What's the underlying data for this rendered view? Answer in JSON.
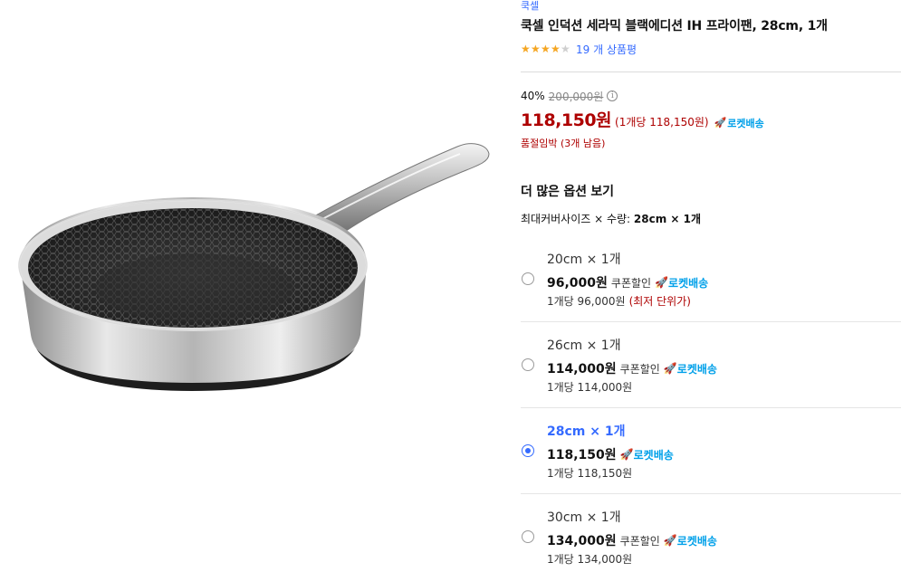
{
  "product": {
    "brand": "쿡셀",
    "title": "쿡셀 인덕션 세라믹 블랙에디션 IH 프라이팬, 28cm, 1개",
    "rating": 4,
    "rating_max": 5,
    "review_count": "19 개 상품평"
  },
  "price": {
    "discount_rate": "40%",
    "original_price": "200,000원",
    "info_icon": "i",
    "sale_price": "118,150원",
    "unit_price": "(1개당 118,150원)",
    "rocket_label": "로켓배송",
    "stock_text": "품절임박 (3개 남음)"
  },
  "options_section": {
    "title": "더 많은 옵션 보기",
    "summary_label": "최대커버사이즈 × 수량:",
    "summary_value": "28cm × 1개"
  },
  "options": [
    {
      "name": "20cm × 1개",
      "price": "96,000원",
      "coupon": "쿠폰할인",
      "rocket": "로켓배송",
      "unit": "1개당 96,000원",
      "lowest": "(최저 단위가)",
      "selected": false
    },
    {
      "name": "26cm × 1개",
      "price": "114,000원",
      "coupon": "쿠폰할인",
      "rocket": "로켓배송",
      "unit": "1개당 114,000원",
      "lowest": "",
      "selected": false
    },
    {
      "name": "28cm × 1개",
      "price": "118,150원",
      "coupon": "",
      "rocket": "로켓배송",
      "unit": "1개당 118,150원",
      "lowest": "",
      "selected": true
    },
    {
      "name": "30cm × 1개",
      "price": "134,000원",
      "coupon": "쿠폰할인",
      "rocket": "로켓배송",
      "unit": "1개당 134,000원",
      "lowest": "",
      "selected": false
    }
  ],
  "colors": {
    "link_blue": "#346aff",
    "sale_red": "#ae0000",
    "rocket_blue": "#00a0e9",
    "star_gold": "#f5a623"
  },
  "icons": {
    "star": "star-icon",
    "rocket": "rocket-icon",
    "info": "info-icon"
  }
}
